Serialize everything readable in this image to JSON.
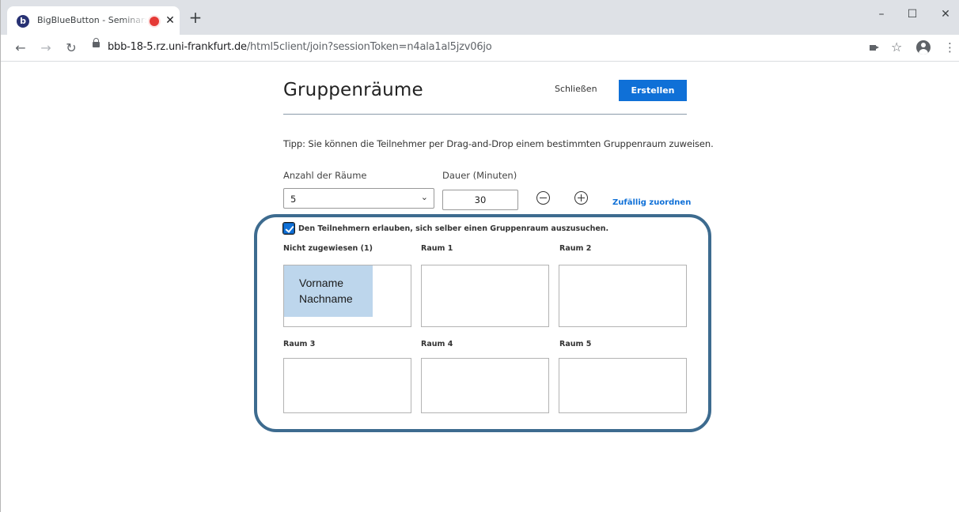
{
  "browser": {
    "tab": {
      "favicon_letter": "b",
      "title": "BigBlueButton - Seminar: Pro",
      "close_glyph": "✕"
    },
    "new_tab_glyph": "+",
    "window_controls": {
      "minimize": "–",
      "maximize": "☐",
      "close": "✕"
    },
    "nav": {
      "back": "←",
      "forward": "→",
      "reload": "↻"
    },
    "url": {
      "host": "bbb-18-5.rz.uni-frankfurt.de",
      "path": "/html5client/join?sessionToken=n4ala1al5jzv06jo"
    },
    "icons": {
      "star": "☆",
      "menu": "⋮"
    }
  },
  "modal": {
    "title": "Gruppenräume",
    "close_label": "Schließen",
    "create_label": "Erstellen",
    "tip": "Tipp: Sie können die Teilnehmer per Drag-and-Drop einem bestimmten Gruppenraum zuweisen.",
    "rooms_count_label": "Anzahl der Räume",
    "rooms_count_value": "5",
    "duration_label": "Dauer (Minuten)",
    "duration_value": "30",
    "decrease_icon": "minus-circle",
    "increase_icon": "plus-circle",
    "random_assign_label": "Zufällig zuordnen",
    "allow_choose_label": "Den Teilnehmern erlauben, sich selber einen Gruppenraum auszusuchen.",
    "allow_choose_checked": true,
    "accent_color": "#0f70d7",
    "highlight_color": "#3d6b8f",
    "rooms": [
      {
        "label": "Nicht zugewiesen (1)"
      },
      {
        "label": "Raum 1"
      },
      {
        "label": "Raum 2"
      },
      {
        "label": "Raum 3"
      },
      {
        "label": "Raum 4"
      },
      {
        "label": "Raum 5"
      }
    ],
    "participant": {
      "first_name": "Vorname",
      "last_name": "Nachname"
    }
  }
}
